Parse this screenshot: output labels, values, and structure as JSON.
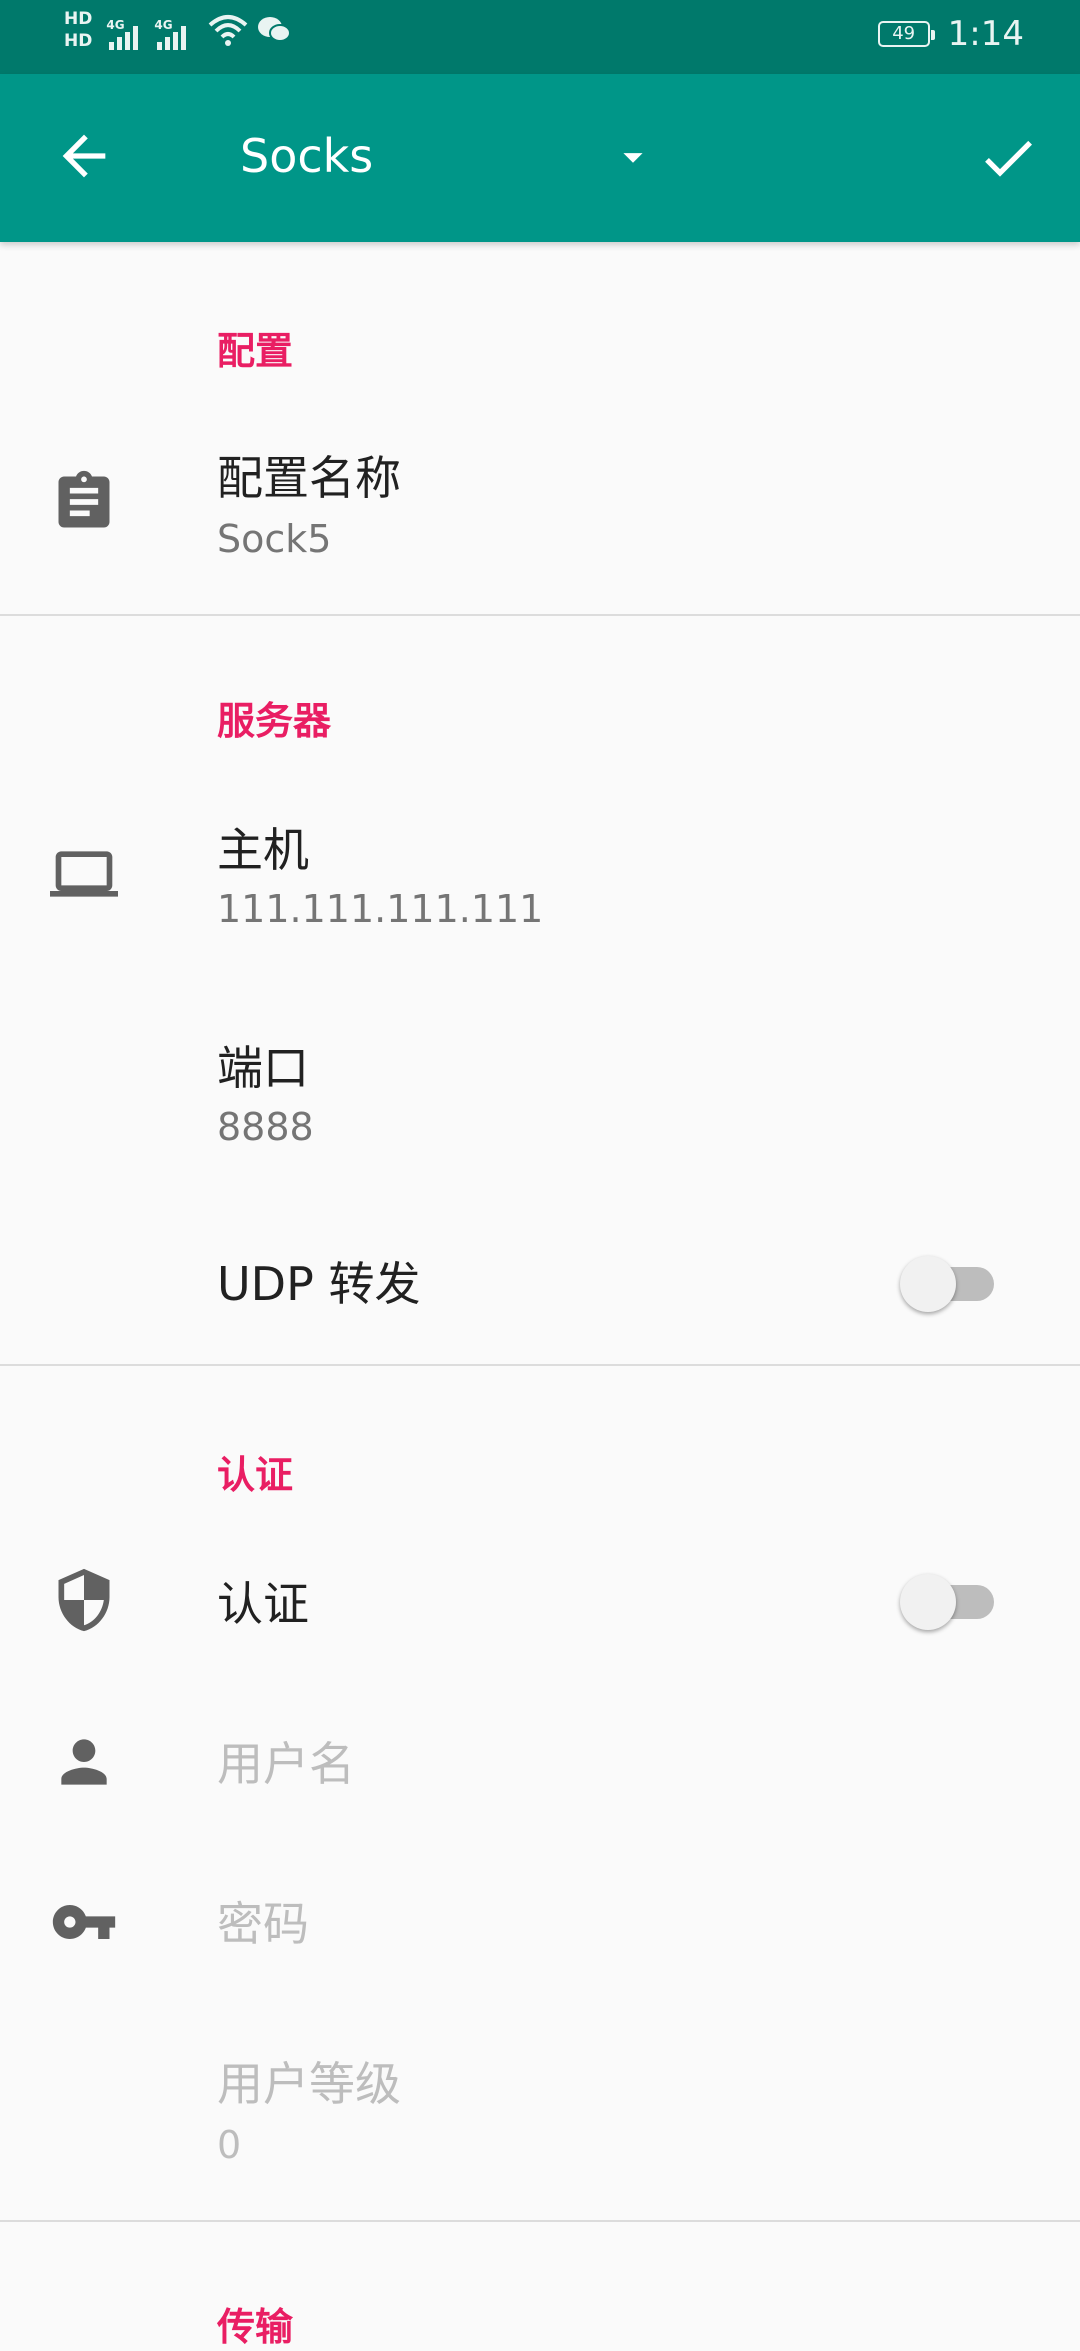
{
  "status_bar": {
    "hd1": "HD",
    "hd2": "HD",
    "net1": "4G",
    "net2": "4G",
    "battery": "49",
    "time": "1:14",
    "icons": [
      "hd-icon",
      "signal-icon",
      "wifi-icon",
      "wechat-icon",
      "battery-icon"
    ]
  },
  "toolbar": {
    "title": "Socks",
    "icons": [
      "back-arrow-icon",
      "dropdown-caret-icon",
      "check-icon"
    ],
    "background": "#009688"
  },
  "sections": {
    "profile": "配置",
    "server": "服务器",
    "auth": "认证",
    "transport": "传输"
  },
  "rows": {
    "profile_name": {
      "title": "配置名称",
      "value": "Sock5"
    },
    "host": {
      "title": "主机",
      "value": "111.111.111.111"
    },
    "port": {
      "title": "端口",
      "value": "8888"
    },
    "udp": {
      "title": "UDP 转发",
      "enabled": false
    },
    "auth": {
      "title": "认证",
      "enabled": false
    },
    "username": {
      "placeholder": "用户名"
    },
    "password": {
      "placeholder": "密码"
    },
    "user_level": {
      "title": "用户等级",
      "value": "0"
    }
  },
  "accent": "#e91e63"
}
